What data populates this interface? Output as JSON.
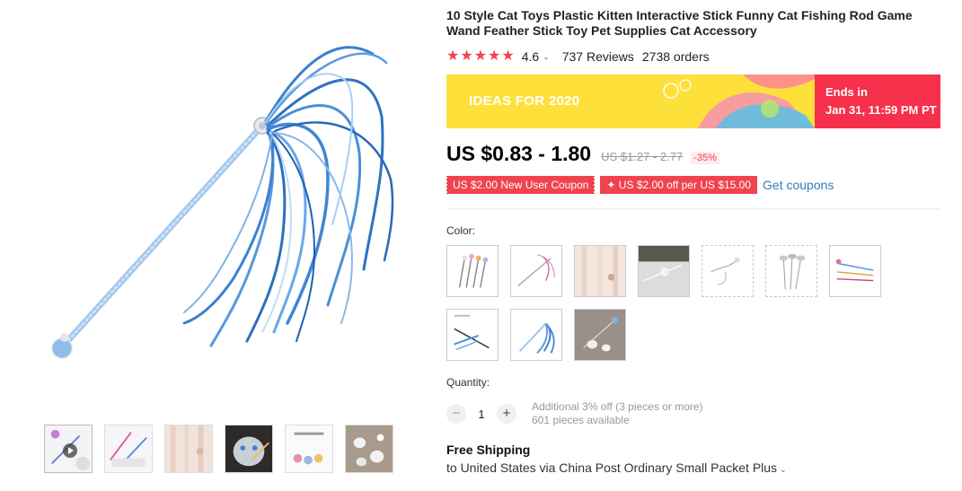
{
  "product": {
    "title": "10 Style Cat Toys Plastic Kitten Interactive Stick Funny Cat Fishing Rod Game Wand Feather Stick Toy Pet Supplies Cat Accessory",
    "rating": "4.6",
    "rating_chevron": "⌄",
    "star_glyph": "★",
    "reviews": "737 Reviews",
    "orders": "2738 orders"
  },
  "promo": {
    "banner_label": "IDEAS FOR 2020",
    "ends_in_label": "Ends in",
    "ends_time": "Jan 31, 11:59 PM PT",
    "colors": {
      "yellow": "#fde13a",
      "red": "#f6304a"
    }
  },
  "price": {
    "current": "US $0.83 - 1.80",
    "original": "US $1.27 - 2.77",
    "discount": "-35%"
  },
  "coupons": {
    "new_user": "US $2.00 New User Coupon",
    "store": "✦ US $2.00 off per US $15.00",
    "get_link": "Get coupons"
  },
  "color": {
    "label": "Color:",
    "options_count": 10
  },
  "quantity": {
    "label": "Quantity:",
    "minus": "−",
    "plus": "+",
    "value": "1",
    "extra_discount": "Additional 3% off (3 pieces or more)",
    "available": "601 pieces available"
  },
  "shipping": {
    "title": "Free Shipping",
    "detail": "to United States via China Post Ordinary Small Packet Plus",
    "chevron": "⌄"
  },
  "gallery": {
    "thumbnail_count": 6,
    "video_thumbnail_index": 0
  },
  "theme": {
    "accent_red": "#f0434e",
    "link_blue": "#2e7dbf",
    "wand_blue": "#4a90d9"
  }
}
